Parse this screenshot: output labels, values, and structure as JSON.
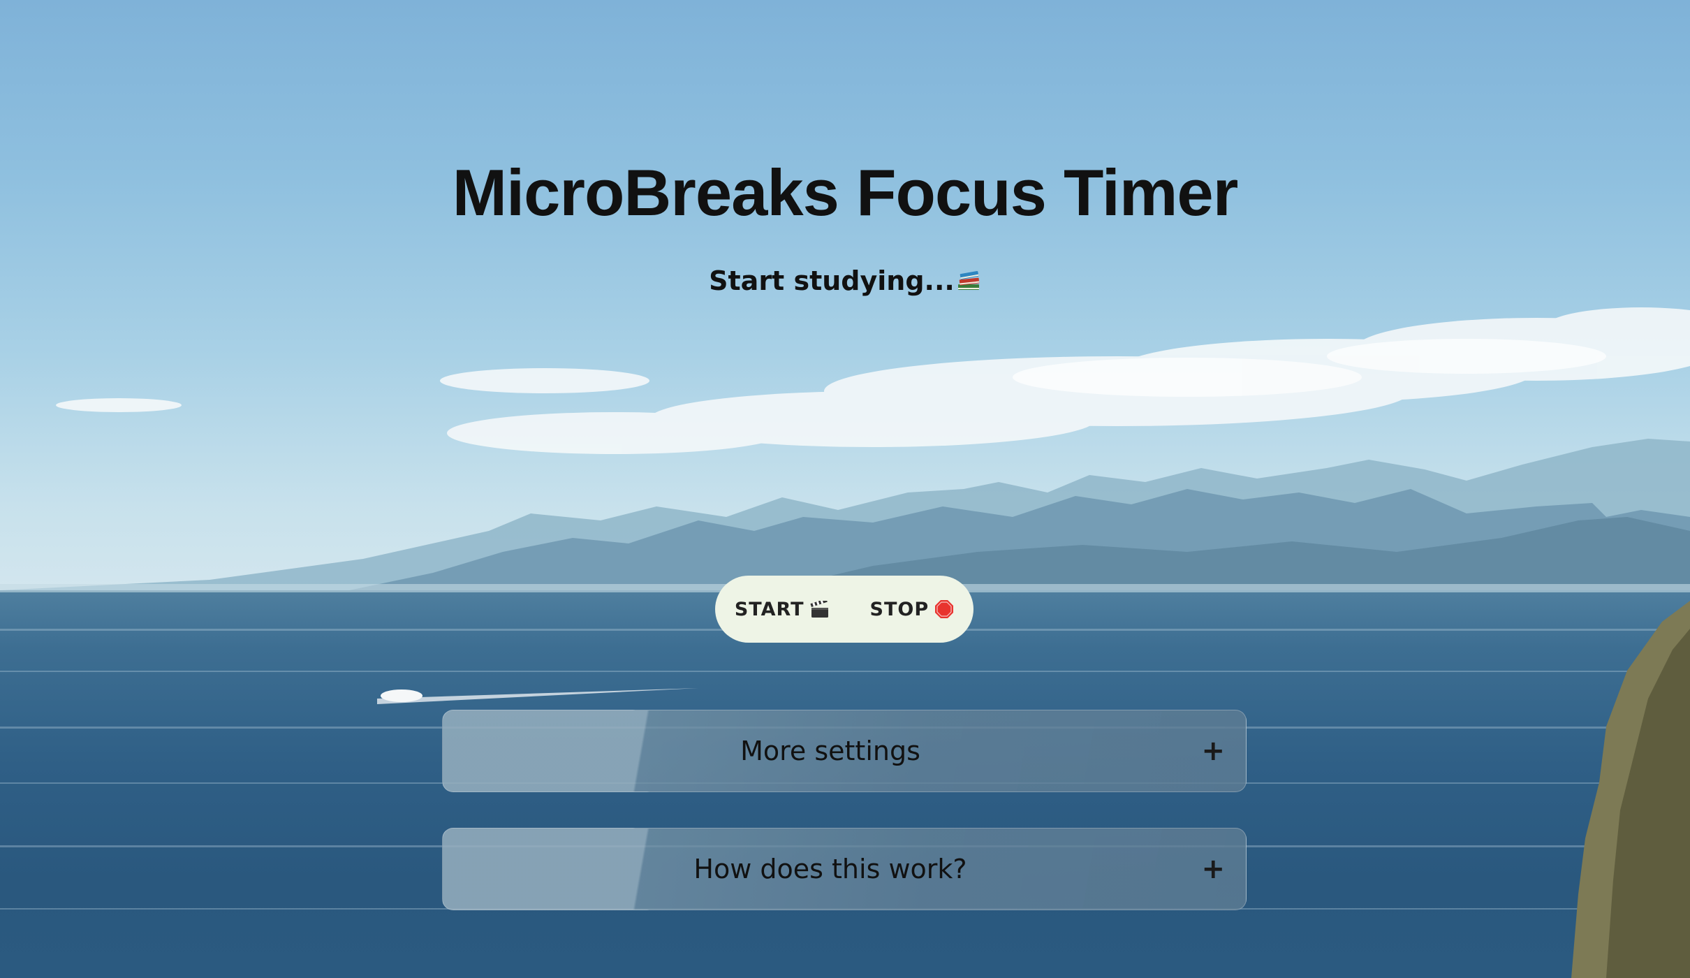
{
  "page": {
    "title": "MicroBreaks Focus Timer",
    "status": "Start studying...",
    "status_icon": "books-icon"
  },
  "controls": {
    "start_label": "START",
    "start_icon": "clapperboard-icon",
    "stop_label": "STOP",
    "stop_icon": "stop-sign-icon"
  },
  "accordions": [
    {
      "label": "More settings",
      "toggle": "+"
    },
    {
      "label": "How does this work?",
      "toggle": "+"
    }
  ],
  "colors": {
    "controls_bg": "#eef4e6",
    "text": "#111111"
  }
}
